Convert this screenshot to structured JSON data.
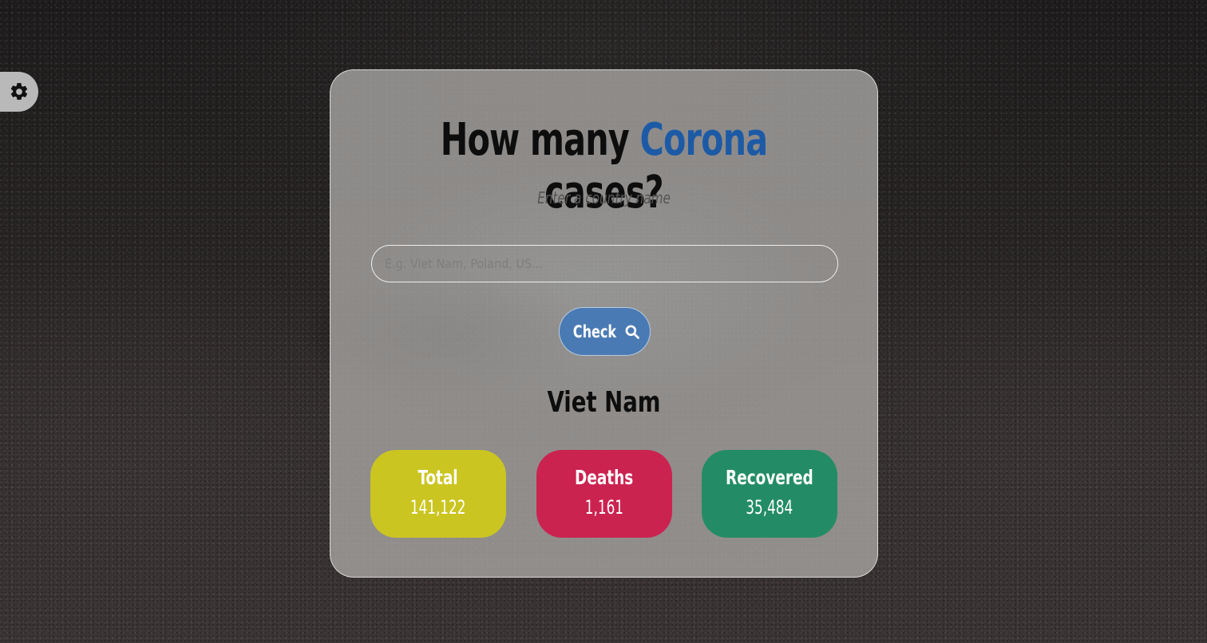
{
  "header": {
    "title_prefix": "How many ",
    "title_accent": "Corona",
    "title_suffix": " cases?",
    "subtitle": "Enter a country name"
  },
  "search": {
    "placeholder": "E.g. Viet Nam, Poland, US...",
    "value": ""
  },
  "check_button": {
    "label": "Check",
    "icon": "search-icon"
  },
  "settings": {
    "icon": "gear-icon"
  },
  "result": {
    "country": "Viet Nam",
    "total": {
      "label": "Total",
      "value": "141,122",
      "color": "#cbc522"
    },
    "deaths": {
      "label": "Deaths",
      "value": "1,161",
      "color": "#cb2350"
    },
    "recovered": {
      "label": "Recovered",
      "value": "35,484",
      "color": "#238c66"
    }
  },
  "colors": {
    "accent": "#1d5aa6",
    "button": "#4a7ab3"
  }
}
